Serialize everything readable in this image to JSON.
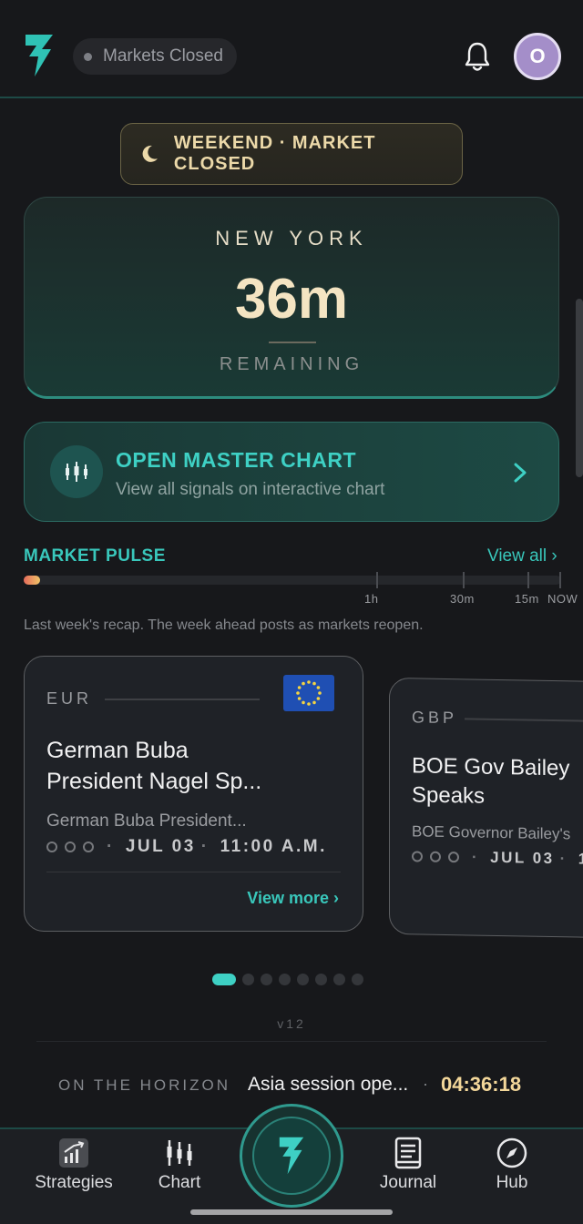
{
  "header": {
    "status": "Markets Closed",
    "avatar_initial": "O",
    "accent_color": "#3ed0c4"
  },
  "weekend_badge": {
    "label": "WEEKEND · MARKET CLOSED"
  },
  "session": {
    "city": "NEW YORK",
    "time": "36m",
    "subtitle": "REMAINING"
  },
  "master_chart": {
    "title": "OPEN MASTER CHART",
    "subtitle": "View all signals on interactive chart"
  },
  "market_pulse": {
    "title": "MARKET PULSE",
    "view_all": "View all ›",
    "progress_fraction": 0.03,
    "ticks": [
      "1h",
      "30m",
      "15m",
      "NOW"
    ],
    "note": "Last week's recap. The week ahead posts as markets reopen."
  },
  "events": [
    {
      "currency": "EUR",
      "title_line1": "German Buba",
      "title_line2": "President Nagel Sp...",
      "description": "German Buba President...",
      "date": "JUL 03",
      "time": "11:00 A.M.",
      "view_more": "View more ›"
    },
    {
      "currency": "GBP",
      "title_line1": "BOE Gov Bailey",
      "title_line2": "Speaks",
      "description": "BOE Governor Bailey's",
      "date": "JUL 03",
      "time": "1"
    }
  ],
  "carousel": {
    "total": 8,
    "active": 0
  },
  "version": "v12",
  "horizon": {
    "label": "ON THE HORIZON",
    "event": "Asia session ope...",
    "separator": "·",
    "countdown": "04:36:18"
  },
  "tabs": {
    "strategies": "Strategies",
    "chart": "Chart",
    "journal": "Journal",
    "hub": "Hub"
  }
}
